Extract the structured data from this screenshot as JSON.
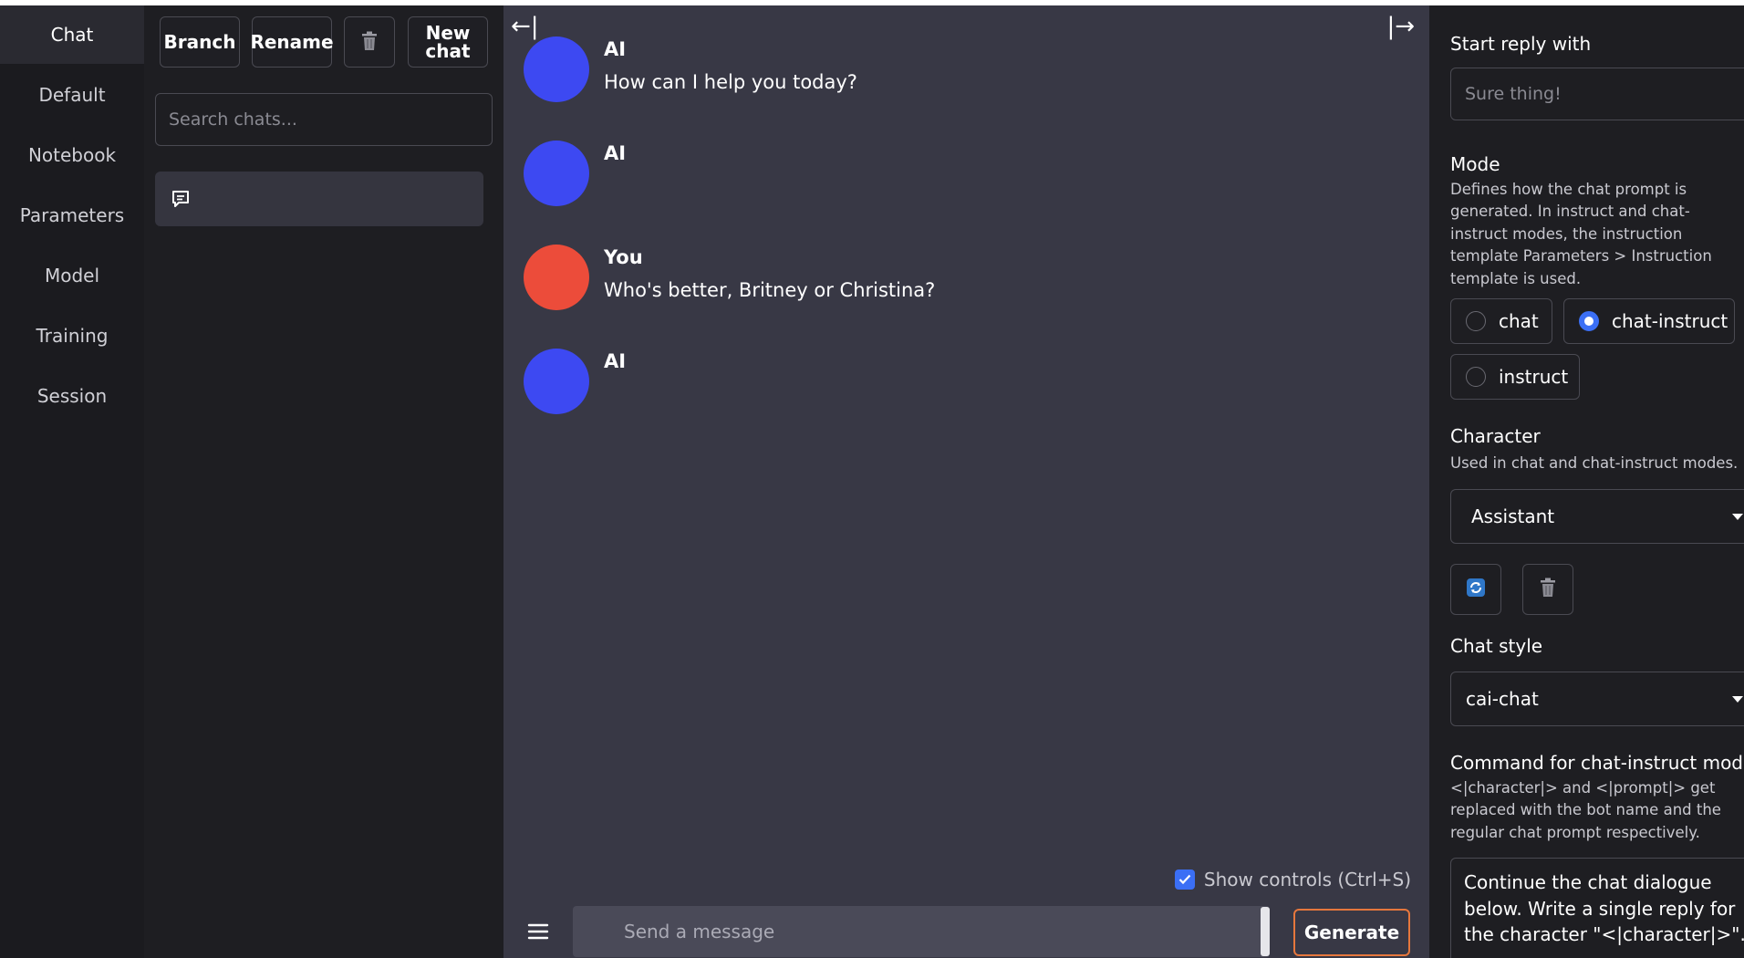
{
  "nav": {
    "items": [
      {
        "label": "Chat"
      },
      {
        "label": "Default"
      },
      {
        "label": "Notebook"
      },
      {
        "label": "Parameters"
      },
      {
        "label": "Model"
      },
      {
        "label": "Training"
      },
      {
        "label": "Session"
      }
    ]
  },
  "history": {
    "branch_label": "Branch",
    "rename_label": "Rename",
    "new_chat_line1": "New",
    "new_chat_line2": "chat",
    "search_placeholder": "Search chats..."
  },
  "chat": {
    "messages": [
      {
        "name": "AI",
        "text": "How can I help you today?",
        "color": "#3d49f2"
      },
      {
        "name": "AI",
        "text": "",
        "color": "#3d49f2"
      },
      {
        "name": "You",
        "text": "Who's better, Britney or Christina?",
        "color": "#ec4c3a"
      },
      {
        "name": "AI",
        "text": "",
        "color": "#3d49f2"
      }
    ],
    "show_controls_label": "Show controls (Ctrl+S)",
    "input_placeholder": "Send a message",
    "generate_label": "Generate"
  },
  "settings": {
    "start_reply_label": "Start reply with",
    "start_reply_placeholder": "Sure thing!",
    "mode_label": "Mode",
    "mode_desc": "Defines how the chat prompt is generated. In instruct and chat-instruct modes, the instruction template Parameters > Instruction template is used.",
    "mode_options": [
      "chat",
      "chat-instruct",
      "instruct"
    ],
    "mode_selected": "chat-instruct",
    "character_label": "Character",
    "character_desc": "Used in chat and chat-instruct modes.",
    "character_value": "Assistant",
    "chat_style_label": "Chat style",
    "chat_style_value": "cai-chat",
    "command_label": "Command for chat-instruct mode",
    "command_desc": "<|character|> and <|prompt|> get replaced with the bot name and the regular chat prompt respectively.",
    "command_line1": "Continue the chat dialogue",
    "command_line2": "below. Write a single reply for",
    "command_line3": "the character \"<|character|>\"."
  },
  "colors": {
    "accent_blue": "#3b6ff5",
    "generate_border": "#e6773d",
    "ai_avatar": "#3d49f2",
    "user_avatar": "#ec4c3a"
  }
}
